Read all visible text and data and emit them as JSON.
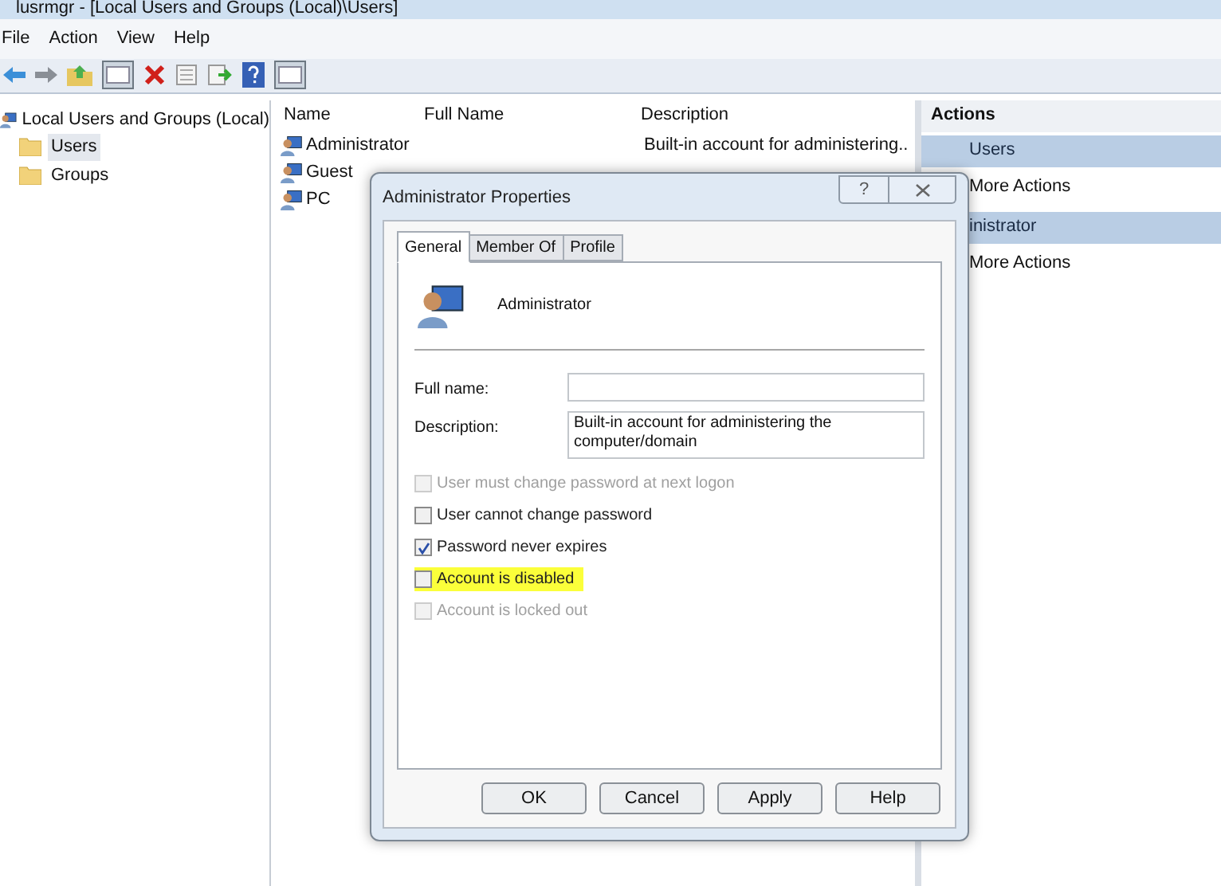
{
  "window": {
    "title": "lusrmgr - [Local Users and Groups (Local)\\Users]"
  },
  "menu": [
    "File",
    "Action",
    "View",
    "Help"
  ],
  "tree": {
    "label": "Local Users and Groups (Local)",
    "children": [
      {
        "label": "Users",
        "selected": true
      },
      {
        "label": "Groups",
        "selected": false
      }
    ]
  },
  "list": {
    "columns": [
      "Name",
      "Full Name",
      "Description"
    ],
    "rows": [
      {
        "name": "Administrator",
        "description": "Built-in account for administering.."
      },
      {
        "name": "Guest"
      },
      {
        "name": "PC"
      }
    ]
  },
  "actions": {
    "title": "Actions",
    "sections": [
      {
        "header": "Users",
        "items": [
          "More Actions"
        ]
      },
      {
        "header": "inistrator",
        "items": [
          "More Actions"
        ]
      }
    ]
  },
  "dialog": {
    "title": "Administrator Properties",
    "help": "?",
    "tabs": [
      {
        "label": "General",
        "selected": true
      },
      {
        "label": "Member Of",
        "selected": false
      },
      {
        "label": "Profile",
        "selected": false
      }
    ],
    "user_name": "Administrator",
    "fields": [
      {
        "label": "Full name:"
      },
      {
        "label": "Description:",
        "value": "Built-in account for administering the computer/domain"
      }
    ],
    "checkboxes": [
      {
        "label": "User must change password at next logon",
        "checked": false,
        "disabled": true,
        "highlighted": false
      },
      {
        "label": "User cannot change password",
        "checked": false,
        "disabled": false,
        "highlighted": false
      },
      {
        "label": "Password never expires",
        "checked": true,
        "disabled": false,
        "highlighted": false
      },
      {
        "label": "Account is disabled",
        "checked": false,
        "disabled": false,
        "highlighted": true
      },
      {
        "label": "Account is locked out",
        "checked": false,
        "disabled": true,
        "highlighted": false
      }
    ],
    "buttons": [
      "OK",
      "Cancel",
      "Apply",
      "Help"
    ]
  }
}
